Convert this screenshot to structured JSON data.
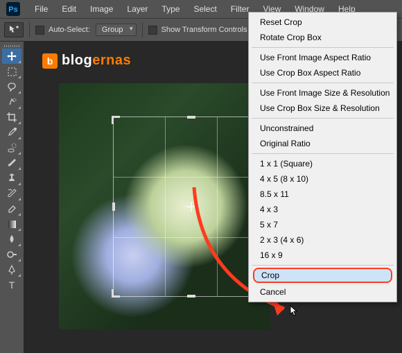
{
  "menubar": {
    "items": [
      "File",
      "Edit",
      "Image",
      "Layer",
      "Type",
      "Select",
      "Filter",
      "View",
      "Window",
      "Help"
    ]
  },
  "optbar": {
    "auto_select_label": "Auto-Select:",
    "group_dropdown": "Group",
    "show_transform_label": "Show Transform Controls"
  },
  "brand": {
    "prefix": "blog",
    "accent": "ernas"
  },
  "context_menu": {
    "groups": [
      [
        "Reset Crop",
        "Rotate Crop Box"
      ],
      [
        "Use Front Image Aspect Ratio",
        "Use Crop Box Aspect Ratio"
      ],
      [
        "Use Front Image Size & Resolution",
        "Use Crop Box Size & Resolution"
      ],
      [
        "Unconstrained",
        "Original Ratio"
      ],
      [
        "1 x 1 (Square)",
        "4 x 5 (8 x 10)",
        "8.5 x 11",
        "4 x 3",
        "5 x 7",
        "2 x 3 (4 x 6)",
        "16 x 9"
      ],
      [
        "Crop",
        "Cancel"
      ]
    ],
    "highlighted": "Crop"
  },
  "tools": [
    "move",
    "marquee",
    "lasso",
    "quick-select",
    "crop",
    "eyedropper",
    "healing",
    "brush",
    "stamp",
    "history-brush",
    "eraser",
    "gradient",
    "blur",
    "dodge",
    "pen",
    "type"
  ]
}
